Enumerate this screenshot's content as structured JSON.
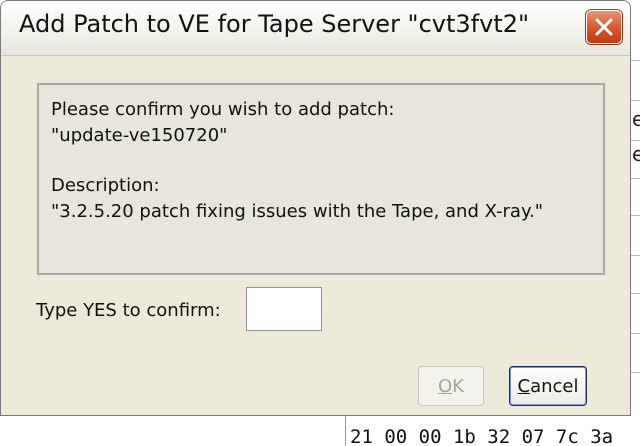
{
  "dialog": {
    "title": "Add Patch to VE for Tape Server \"cvt3fvt2\"",
    "close_icon": "close-x-icon",
    "message": {
      "line1": "Please confirm you wish to add patch:",
      "line2": "\"update-ve150720\"",
      "line3": "Description:",
      "line4": "\"3.2.5.20 patch fixing issues with the Tape, and X-ray.\""
    },
    "confirm_label": "Type YES to confirm:",
    "confirm_value": "",
    "ok_mnemonic": "O",
    "ok_rest": "K",
    "cancel_mnemonic": "C",
    "cancel_rest": "ancel"
  },
  "background": {
    "bottom_text": "21 00 00 1b 32 07 7c 3a",
    "clipped_chars": [
      "e",
      "e"
    ]
  },
  "colors": {
    "dialog_bg": "#ece9d8",
    "close_button": "#d6552c",
    "cancel_focus_border": "#1f2f5b"
  }
}
